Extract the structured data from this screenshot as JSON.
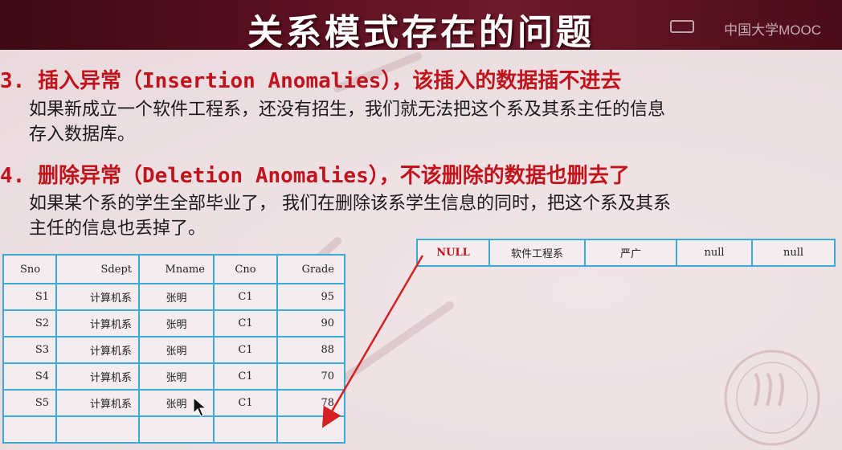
{
  "header": {
    "title": "关系模式存在的问题",
    "brand": "中国大学MOOC"
  },
  "sections": [
    {
      "heading": "3. 插入异常（Insertion Anomalies），该插入的数据插不进去",
      "lines": [
        "如果新成立一个软件工程系，还没有招生，我们就无法把这个系及其系主任的信息",
        "存入数据库。"
      ]
    },
    {
      "heading": "4. 删除异常（Deletion Anomalies），不该删除的数据也删去了",
      "lines": [
        "如果某个系的学生全部毕业了， 我们在删除该系学生信息的同时，把这个系及其系",
        "主任的信息也丢掉了。"
      ]
    }
  ],
  "student_table": {
    "columns": [
      "Sno",
      "Sdept",
      "Mname",
      "Cno",
      "Grade"
    ],
    "rows": [
      [
        "S1",
        "计算机系",
        "张明",
        "C1",
        "95"
      ],
      [
        "S2",
        "计算机系",
        "张明",
        "C1",
        "90"
      ],
      [
        "S3",
        "计算机系",
        "张明",
        "C1",
        "88"
      ],
      [
        "S4",
        "计算机系",
        "张明",
        "C1",
        "70"
      ],
      [
        "S5",
        "计算机系",
        "张明",
        "C1",
        "78"
      ],
      [
        "",
        "",
        "",
        "",
        ""
      ]
    ]
  },
  "new_row": [
    "NULL",
    "软件工程系",
    "严广",
    "null",
    "null"
  ],
  "colors": {
    "title_bg": "#5a1020",
    "heading": "#c0141c",
    "table_border": "#3da9d6",
    "arrow": "#d42020"
  }
}
